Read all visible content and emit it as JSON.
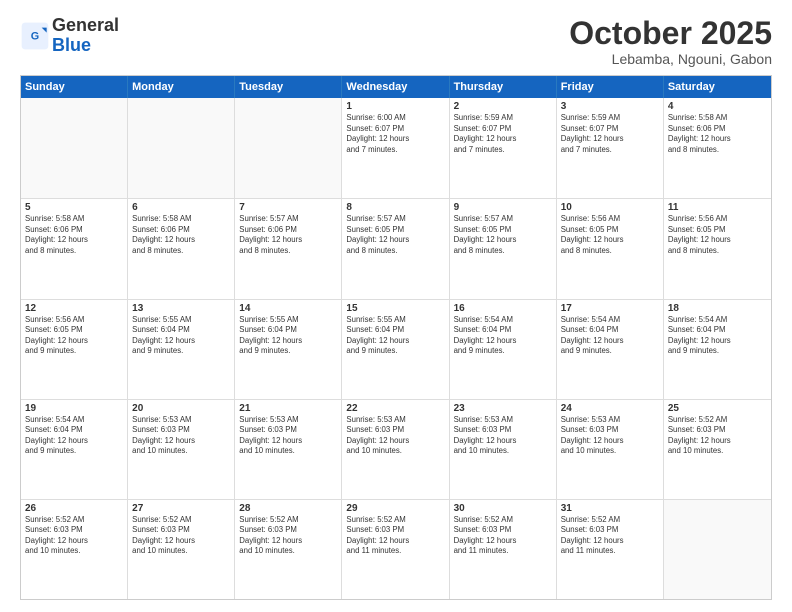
{
  "header": {
    "logo_line1": "General",
    "logo_line2": "Blue",
    "month": "October 2025",
    "location": "Lebamba, Ngouni, Gabon"
  },
  "days": [
    "Sunday",
    "Monday",
    "Tuesday",
    "Wednesday",
    "Thursday",
    "Friday",
    "Saturday"
  ],
  "weeks": [
    [
      {
        "day": "",
        "text": ""
      },
      {
        "day": "",
        "text": ""
      },
      {
        "day": "",
        "text": ""
      },
      {
        "day": "1",
        "text": "Sunrise: 6:00 AM\nSunset: 6:07 PM\nDaylight: 12 hours\nand 7 minutes."
      },
      {
        "day": "2",
        "text": "Sunrise: 5:59 AM\nSunset: 6:07 PM\nDaylight: 12 hours\nand 7 minutes."
      },
      {
        "day": "3",
        "text": "Sunrise: 5:59 AM\nSunset: 6:07 PM\nDaylight: 12 hours\nand 7 minutes."
      },
      {
        "day": "4",
        "text": "Sunrise: 5:58 AM\nSunset: 6:06 PM\nDaylight: 12 hours\nand 8 minutes."
      }
    ],
    [
      {
        "day": "5",
        "text": "Sunrise: 5:58 AM\nSunset: 6:06 PM\nDaylight: 12 hours\nand 8 minutes."
      },
      {
        "day": "6",
        "text": "Sunrise: 5:58 AM\nSunset: 6:06 PM\nDaylight: 12 hours\nand 8 minutes."
      },
      {
        "day": "7",
        "text": "Sunrise: 5:57 AM\nSunset: 6:06 PM\nDaylight: 12 hours\nand 8 minutes."
      },
      {
        "day": "8",
        "text": "Sunrise: 5:57 AM\nSunset: 6:05 PM\nDaylight: 12 hours\nand 8 minutes."
      },
      {
        "day": "9",
        "text": "Sunrise: 5:57 AM\nSunset: 6:05 PM\nDaylight: 12 hours\nand 8 minutes."
      },
      {
        "day": "10",
        "text": "Sunrise: 5:56 AM\nSunset: 6:05 PM\nDaylight: 12 hours\nand 8 minutes."
      },
      {
        "day": "11",
        "text": "Sunrise: 5:56 AM\nSunset: 6:05 PM\nDaylight: 12 hours\nand 8 minutes."
      }
    ],
    [
      {
        "day": "12",
        "text": "Sunrise: 5:56 AM\nSunset: 6:05 PM\nDaylight: 12 hours\nand 9 minutes."
      },
      {
        "day": "13",
        "text": "Sunrise: 5:55 AM\nSunset: 6:04 PM\nDaylight: 12 hours\nand 9 minutes."
      },
      {
        "day": "14",
        "text": "Sunrise: 5:55 AM\nSunset: 6:04 PM\nDaylight: 12 hours\nand 9 minutes."
      },
      {
        "day": "15",
        "text": "Sunrise: 5:55 AM\nSunset: 6:04 PM\nDaylight: 12 hours\nand 9 minutes."
      },
      {
        "day": "16",
        "text": "Sunrise: 5:54 AM\nSunset: 6:04 PM\nDaylight: 12 hours\nand 9 minutes."
      },
      {
        "day": "17",
        "text": "Sunrise: 5:54 AM\nSunset: 6:04 PM\nDaylight: 12 hours\nand 9 minutes."
      },
      {
        "day": "18",
        "text": "Sunrise: 5:54 AM\nSunset: 6:04 PM\nDaylight: 12 hours\nand 9 minutes."
      }
    ],
    [
      {
        "day": "19",
        "text": "Sunrise: 5:54 AM\nSunset: 6:04 PM\nDaylight: 12 hours\nand 9 minutes."
      },
      {
        "day": "20",
        "text": "Sunrise: 5:53 AM\nSunset: 6:03 PM\nDaylight: 12 hours\nand 10 minutes."
      },
      {
        "day": "21",
        "text": "Sunrise: 5:53 AM\nSunset: 6:03 PM\nDaylight: 12 hours\nand 10 minutes."
      },
      {
        "day": "22",
        "text": "Sunrise: 5:53 AM\nSunset: 6:03 PM\nDaylight: 12 hours\nand 10 minutes."
      },
      {
        "day": "23",
        "text": "Sunrise: 5:53 AM\nSunset: 6:03 PM\nDaylight: 12 hours\nand 10 minutes."
      },
      {
        "day": "24",
        "text": "Sunrise: 5:53 AM\nSunset: 6:03 PM\nDaylight: 12 hours\nand 10 minutes."
      },
      {
        "day": "25",
        "text": "Sunrise: 5:52 AM\nSunset: 6:03 PM\nDaylight: 12 hours\nand 10 minutes."
      }
    ],
    [
      {
        "day": "26",
        "text": "Sunrise: 5:52 AM\nSunset: 6:03 PM\nDaylight: 12 hours\nand 10 minutes."
      },
      {
        "day": "27",
        "text": "Sunrise: 5:52 AM\nSunset: 6:03 PM\nDaylight: 12 hours\nand 10 minutes."
      },
      {
        "day": "28",
        "text": "Sunrise: 5:52 AM\nSunset: 6:03 PM\nDaylight: 12 hours\nand 10 minutes."
      },
      {
        "day": "29",
        "text": "Sunrise: 5:52 AM\nSunset: 6:03 PM\nDaylight: 12 hours\nand 11 minutes."
      },
      {
        "day": "30",
        "text": "Sunrise: 5:52 AM\nSunset: 6:03 PM\nDaylight: 12 hours\nand 11 minutes."
      },
      {
        "day": "31",
        "text": "Sunrise: 5:52 AM\nSunset: 6:03 PM\nDaylight: 12 hours\nand 11 minutes."
      },
      {
        "day": "",
        "text": ""
      }
    ]
  ]
}
